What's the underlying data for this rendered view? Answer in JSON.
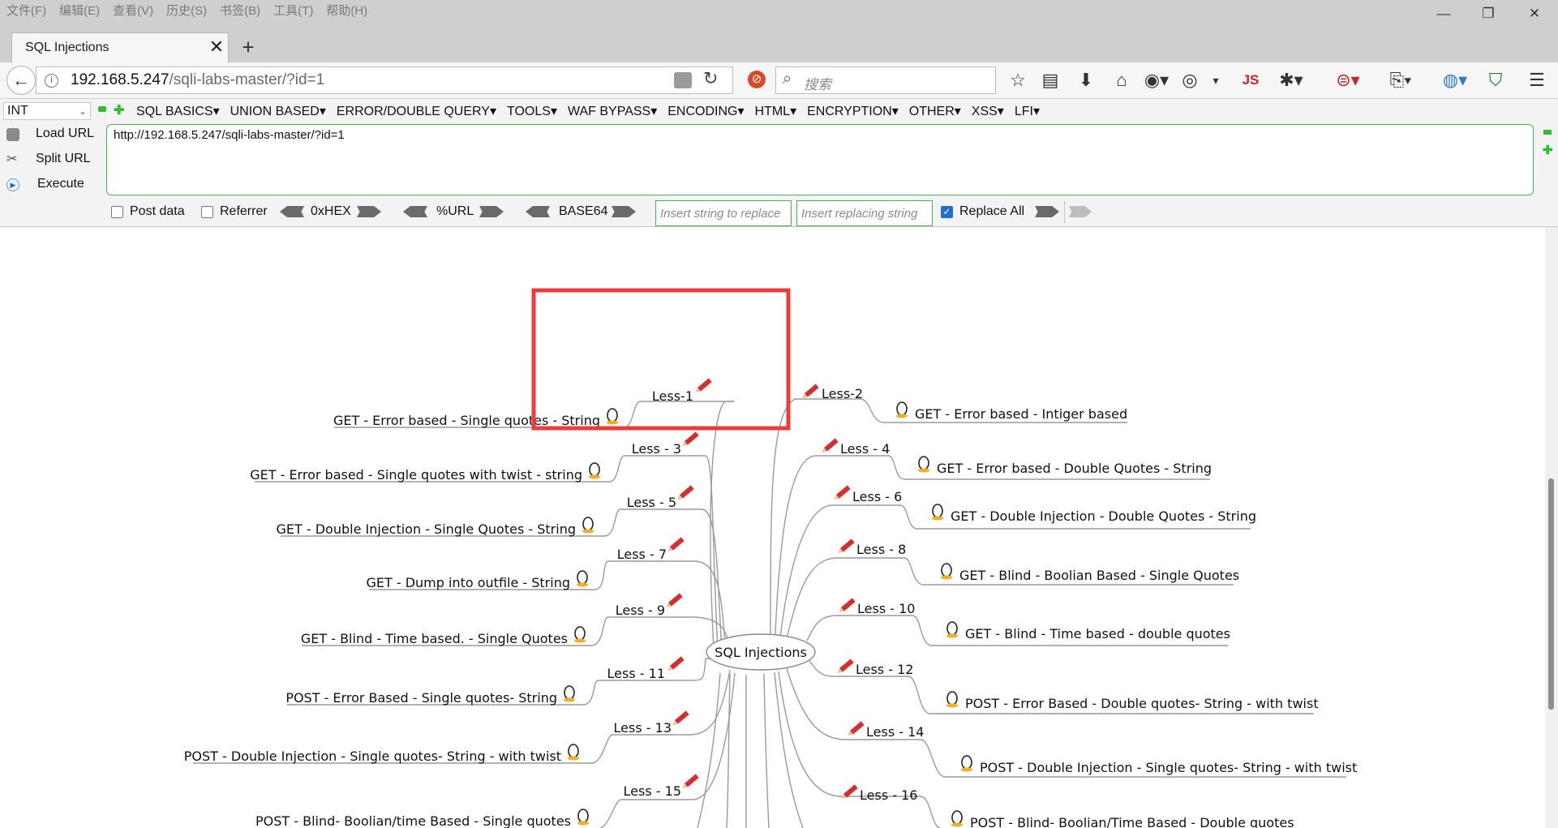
{
  "menubar": [
    "文件(F)",
    "编辑(E)",
    "查看(V)",
    "历史(S)",
    "书签(B)",
    "工具(T)",
    "帮助(H)"
  ],
  "window": {
    "minimize": "—",
    "restore": "❐",
    "close": "✕"
  },
  "tab": {
    "title": "SQL Injections",
    "close": "✕",
    "new_tab": "+"
  },
  "nav": {
    "back": "←",
    "url_host": "192.168.5.247",
    "url_path": "/sqli-labs-master/?id=1",
    "search_placeholder": "搜索",
    "js_badge": "JS"
  },
  "hackbar": {
    "type_select": "INT",
    "menus": [
      "SQL BASICS",
      "UNION BASED",
      "ERROR/DOUBLE QUERY",
      "TOOLS",
      "WAF BYPASS",
      "ENCODING",
      "HTML",
      "ENCRYPTION",
      "OTHER",
      "XSS",
      "LFI"
    ],
    "load_url": "Load URL",
    "split_url": "Split URL",
    "execute": "Execute",
    "url_value": "http://192.168.5.247/sqli-labs-master/?id=1",
    "post_data": "Post data",
    "referrer": "Referrer",
    "hex": "0xHEX",
    "urlenc": "%URL",
    "base64": "BASE64",
    "replace_placeholder": "Insert string to replace",
    "replacing_placeholder": "Insert replacing string",
    "replace_all": "Replace All",
    "post_data_checked": false,
    "referrer_checked": false,
    "replace_all_checked": true
  },
  "mindmap": {
    "center": "SQL Injections",
    "left": [
      {
        "less": "Less-1",
        "desc": "GET - Error based - Single quotes - String"
      },
      {
        "less": "Less - 3",
        "desc": "GET - Error based - Single quotes with twist - string"
      },
      {
        "less": "Less - 5",
        "desc": "GET - Double Injection - Single Quotes - String"
      },
      {
        "less": "Less - 7",
        "desc": "GET - Dump into outfile - String"
      },
      {
        "less": "Less - 9",
        "desc": "GET - Blind - Time based. -  Single Quotes"
      },
      {
        "less": "Less - 11",
        "desc": "POST - Error Based - Single quotes- String"
      },
      {
        "less": "Less - 13",
        "desc": "POST - Double Injection - Single quotes- String - with twist"
      },
      {
        "less": "Less - 15",
        "desc": "POST - Blind- Boolian/time Based - Single quotes"
      }
    ],
    "right": [
      {
        "less": "Less-2",
        "desc": "GET - Error based - Intiger based"
      },
      {
        "less": "Less - 4",
        "desc": "GET - Error based - Double Quotes - String"
      },
      {
        "less": "Less - 6",
        "desc": "GET - Double Injection - Double Quotes - String"
      },
      {
        "less": "Less - 8",
        "desc": "GET - Blind - Boolian Based - Single Quotes"
      },
      {
        "less": "Less - 10",
        "desc": "GET - Blind - Time based - double quotes"
      },
      {
        "less": "Less - 12",
        "desc": "POST - Error Based - Double quotes- String - with twist"
      },
      {
        "less": "Less - 14",
        "desc": "POST - Double Injection - Single quotes- String - with twist"
      },
      {
        "less": "Less - 16",
        "desc": "POST - Blind- Boolian/Time Based - Double quotes"
      }
    ]
  }
}
